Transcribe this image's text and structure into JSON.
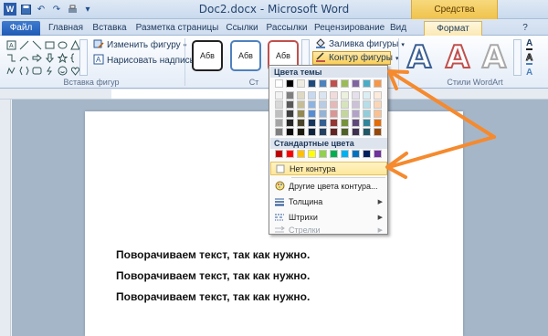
{
  "window": {
    "title": "Doc2.docx - Microsoft Word",
    "context_tab_title": "Средства рисования"
  },
  "tabs": [
    {
      "label": "Файл"
    },
    {
      "label": "Главная"
    },
    {
      "label": "Вставка"
    },
    {
      "label": "Разметка страницы"
    },
    {
      "label": "Ссылки"
    },
    {
      "label": "Рассылки"
    },
    {
      "label": "Рецензирование"
    },
    {
      "label": "Вид"
    },
    {
      "label": "Формат"
    }
  ],
  "ribbon": {
    "edit_shape_label": "Изменить фигуру",
    "draw_textbox_label": "Нарисовать надпись",
    "insert_shapes_group": "Вставка фигур",
    "styles_group_short": "Ст",
    "shape_fill_label": "Заливка фигуры",
    "shape_outline_label": "Контур фигуры",
    "wordart_group": "Стили WordArt",
    "style_samples": [
      "Абв",
      "Абв",
      "Абв"
    ],
    "wordart_letter": "A"
  },
  "dropdown": {
    "theme_colors_header": "Цвета темы",
    "standard_colors_header": "Стандартные цвета",
    "theme_colors_top": [
      "#ffffff",
      "#000000",
      "#eeece1",
      "#1f497d",
      "#4f81bd",
      "#c0504d",
      "#9bbb59",
      "#8064a2",
      "#4bacc6",
      "#f79646"
    ],
    "theme_colors_shades": [
      [
        "#f2f2f2",
        "#7f7f7f",
        "#ddd9c3",
        "#c6d9f0",
        "#dbe5f1",
        "#f2dcdb",
        "#ebf1dd",
        "#e5e0ec",
        "#dbeef3",
        "#fdeada"
      ],
      [
        "#d8d8d8",
        "#595959",
        "#c4bd97",
        "#8db3e2",
        "#b8cce4",
        "#e5b9b7",
        "#d7e3bc",
        "#ccc1d9",
        "#b7dde8",
        "#fbd5b5"
      ],
      [
        "#bfbfbf",
        "#3f3f3f",
        "#938953",
        "#548dd4",
        "#95b3d7",
        "#d99694",
        "#c3d69b",
        "#b2a2c7",
        "#92cddc",
        "#fac08f"
      ],
      [
        "#a5a5a5",
        "#262626",
        "#494429",
        "#17365d",
        "#366092",
        "#953734",
        "#76923c",
        "#5f497a",
        "#31859b",
        "#e36c09"
      ],
      [
        "#7f7f7f",
        "#0c0c0c",
        "#1d1b10",
        "#0f243e",
        "#244061",
        "#632423",
        "#4f6128",
        "#3f3151",
        "#205867",
        "#974806"
      ]
    ],
    "standard_colors": [
      "#c00000",
      "#ff0000",
      "#ffc000",
      "#ffff00",
      "#92d050",
      "#00b050",
      "#00b0f0",
      "#0070c0",
      "#002060",
      "#7030a0"
    ],
    "items": {
      "no_outline": "Нет контура",
      "more_colors": "Другие цвета контура...",
      "weight": "Толщина",
      "dashes": "Штрихи",
      "arrows": "Стрелки"
    }
  },
  "document": {
    "lines": [
      "Поворачиваем текст, так как нужно.",
      "Поворачиваем текст, так как нужно.",
      "Поворачиваем текст, так как нужно."
    ]
  },
  "colors": {
    "annotation_arrow": "#f58a2e",
    "highlight": "#fde79a"
  }
}
